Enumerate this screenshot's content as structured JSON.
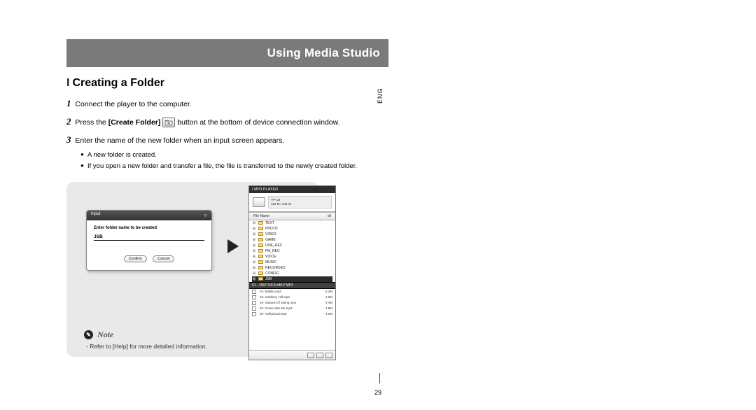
{
  "header": {
    "title": "Using Media Studio"
  },
  "section": {
    "bar": "I",
    "title": "Creating a Folder",
    "lang_tag": "ENG"
  },
  "steps": {
    "1": {
      "num": "1",
      "text": "Connect the player to the computer."
    },
    "2": {
      "num": "2",
      "pre": "Press the ",
      "bold": "[Create Folder]",
      "post": " button at the bottom of device connection window."
    },
    "3": {
      "num": "3",
      "text": "Enter the name of the new folder when an input screen appears."
    }
  },
  "bullets": {
    "a": "A new folder is created.",
    "b": "If you open a new folder and transfer a file, the file is transferred to the newly created folder."
  },
  "dialog": {
    "title": "Input",
    "label": "Enter folder name to be created",
    "value": "JSB",
    "confirm": "Confirm",
    "cancel": "Cancel"
  },
  "note": {
    "badge": "✎",
    "label": "Note",
    "text": "- Refer to [Help] for more detailed information.",
    "help_bold": "[Help]"
  },
  "device": {
    "title": "I  MP3 PLAYER",
    "model": "YP-U2",
    "storage": "103 M / 241 M",
    "col1": "File Name",
    "col2": "v9",
    "folders": [
      "TEXT",
      "PHOTO",
      "VIDEO",
      "GAME",
      "LINE_REC",
      "FM_REC",
      "VOICE",
      "MUSIC",
      "RECORDED",
      "CONFIG"
    ],
    "selected": "JSB",
    "files_folder_label": "01 - 2007 OSTs MKV  MP3",
    "files": [
      {
        "n": "01- Malibu.mp3",
        "s": "5.2M"
      },
      {
        "n": "02- Solsbury Hill.mp3",
        "s": "4.0M"
      },
      {
        "n": "03- Sultans Of Swing.mp3",
        "s": "5.4M"
      },
      {
        "n": "04- Come with Me.mp3",
        "s": "4.8M"
      },
      {
        "n": "05- Hollywood.mp3",
        "s": "4.2M"
      }
    ]
  },
  "page": {
    "number": "29"
  }
}
